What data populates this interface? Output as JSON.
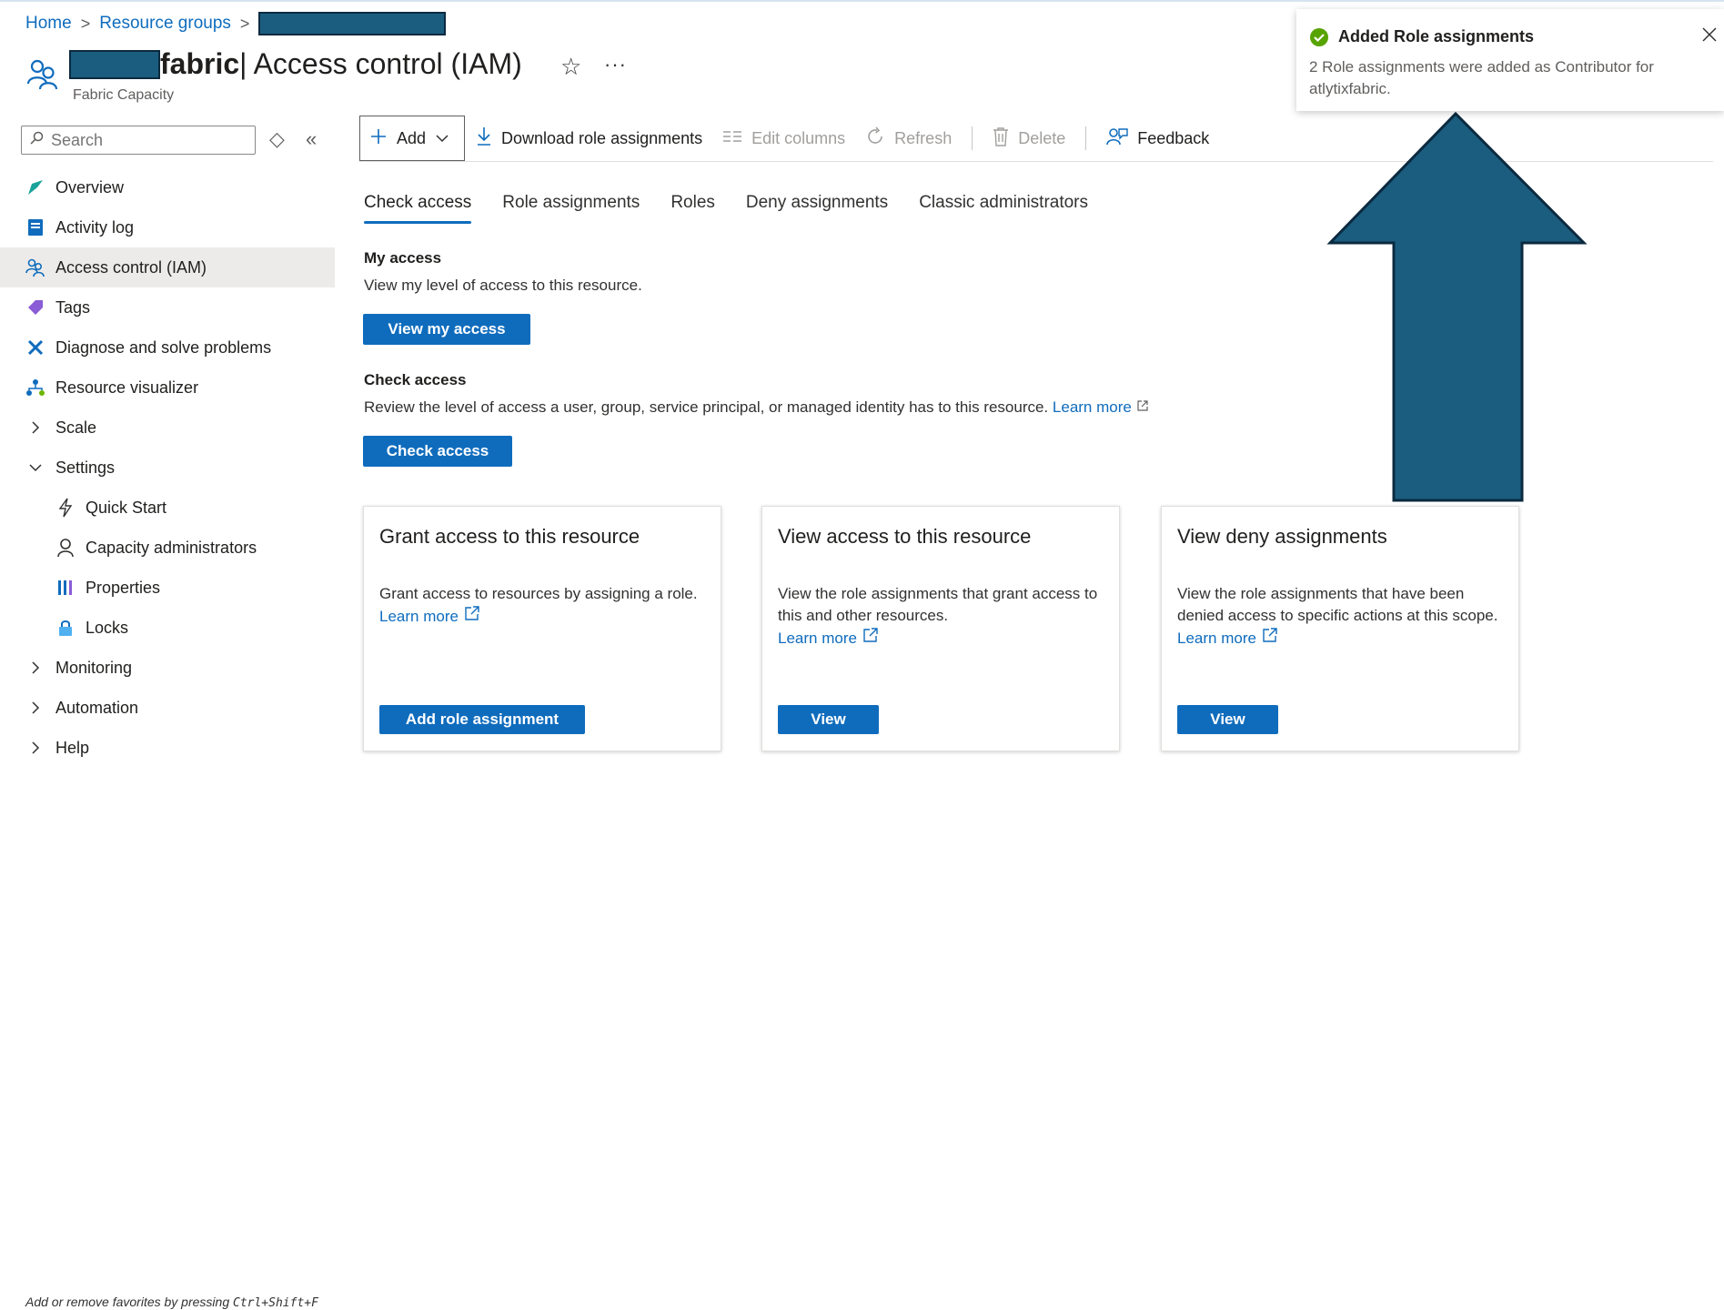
{
  "breadcrumb": {
    "home": "Home",
    "resource_groups": "Resource groups",
    "separator": ">"
  },
  "header": {
    "title_suffix": "fabric",
    "title_main": " | Access control (IAM)",
    "subtitle": "Fabric Capacity",
    "more": "···"
  },
  "sidebar": {
    "search_placeholder": "Search",
    "items": [
      {
        "label": "Overview",
        "icon": "overview-icon"
      },
      {
        "label": "Activity log",
        "icon": "activity-log-icon"
      },
      {
        "label": "Access control (IAM)",
        "icon": "iam-icon",
        "selected": true
      },
      {
        "label": "Tags",
        "icon": "tag-icon"
      },
      {
        "label": "Diagnose and solve problems",
        "icon": "wrench-icon"
      },
      {
        "label": "Resource visualizer",
        "icon": "hierarchy-icon"
      },
      {
        "label": "Scale",
        "icon": "chevron-right-icon"
      },
      {
        "label": "Settings",
        "icon": "chevron-down-icon"
      },
      {
        "label": "Quick Start",
        "icon": "lightning-icon"
      },
      {
        "label": "Capacity administrators",
        "icon": "person-icon"
      },
      {
        "label": "Properties",
        "icon": "properties-icon"
      },
      {
        "label": "Locks",
        "icon": "lock-icon"
      },
      {
        "label": "Monitoring",
        "icon": "chevron-right-icon"
      },
      {
        "label": "Automation",
        "icon": "chevron-right-icon"
      },
      {
        "label": "Help",
        "icon": "chevron-right-icon"
      }
    ]
  },
  "toolbar": {
    "add": "Add",
    "download": "Download role assignments",
    "edit_columns": "Edit columns",
    "refresh": "Refresh",
    "delete": "Delete",
    "feedback": "Feedback"
  },
  "tabs": [
    {
      "label": "Check access",
      "active": true
    },
    {
      "label": "Role assignments"
    },
    {
      "label": "Roles"
    },
    {
      "label": "Deny assignments"
    },
    {
      "label": "Classic administrators"
    }
  ],
  "my_access": {
    "heading": "My access",
    "text": "View my level of access to this resource.",
    "button": "View my access"
  },
  "check_access": {
    "heading": "Check access",
    "text": "Review the level of access a user, group, service principal, or managed identity has to this resource.",
    "link": "Learn more",
    "button": "Check access"
  },
  "cards": [
    {
      "title": "Grant access to this resource",
      "desc": "Grant access to resources by assigning a role.",
      "link": "Learn more",
      "button": "Add role assignment"
    },
    {
      "title": "View access to this resource",
      "desc": "View the role assignments that grant access to this and other resources.",
      "link": "Learn more",
      "button": "View"
    },
    {
      "title": "View deny assignments",
      "desc": "View the role assignments that have been denied access to specific actions at this scope.",
      "link": "Learn more",
      "button": "View"
    }
  ],
  "toast": {
    "title": "Added Role assignments",
    "message": "2 Role assignments were added as Contributor for atlytixfabric."
  },
  "footer": {
    "hint_prefix": "Add or remove favorites by pressing ",
    "shortcut": "Ctrl+Shift+F"
  },
  "colors": {
    "accent": "#0f6cbd",
    "arrow_fill": "#1b5d7e",
    "arrow_stroke": "#0b2a40",
    "success": "#107c10"
  }
}
